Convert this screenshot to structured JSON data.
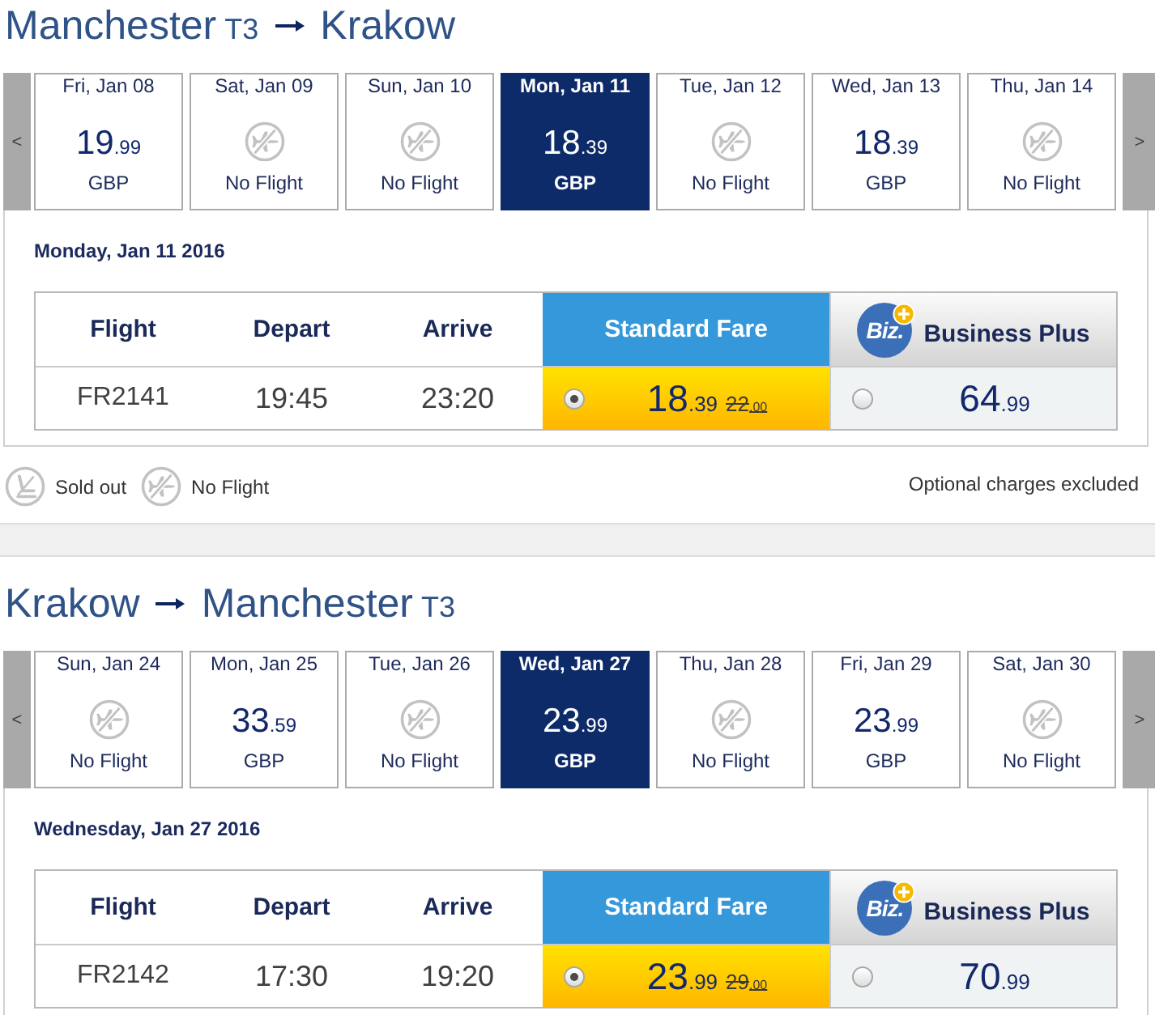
{
  "outbound": {
    "from": {
      "city": "Manchester",
      "terminal": "T3"
    },
    "to": {
      "city": "Krakow"
    },
    "nav": {
      "prev": "<",
      "next": ">"
    },
    "dates": [
      {
        "kind": "fare",
        "label": "Fri, Jan 08",
        "price": {
          "whole": "19",
          "decimals": ".99"
        },
        "currency": "GBP",
        "selected": false
      },
      {
        "kind": "no_flight",
        "label": "Sat, Jan 09",
        "status": "No Flight",
        "selected": false
      },
      {
        "kind": "no_flight",
        "label": "Sun, Jan 10",
        "status": "No Flight",
        "selected": false
      },
      {
        "kind": "fare",
        "label": "Mon, Jan 11",
        "price": {
          "whole": "18",
          "decimals": ".39"
        },
        "currency": "GBP",
        "selected": true
      },
      {
        "kind": "no_flight",
        "label": "Tue, Jan 12",
        "status": "No Flight",
        "selected": false
      },
      {
        "kind": "fare",
        "label": "Wed, Jan 13",
        "price": {
          "whole": "18",
          "decimals": ".39"
        },
        "currency": "GBP",
        "selected": false
      },
      {
        "kind": "no_flight",
        "label": "Thu, Jan 14",
        "status": "No Flight",
        "selected": false
      }
    ],
    "day_heading": "Monday, Jan 11 2016",
    "table": {
      "columns": [
        "Flight",
        "Depart",
        "Arrive"
      ],
      "fare_columns": [
        {
          "kind": "standard",
          "name": "Standard Fare"
        },
        {
          "kind": "business",
          "name": "Business Plus",
          "logo": "Biz."
        }
      ],
      "rows": [
        {
          "flight": "FR2141",
          "depart": "19:45",
          "arrive": "23:20",
          "fares": [
            {
              "price": {
                "whole": "18",
                "decimals": ".39"
              },
              "old_price": {
                "whole": "22",
                "decimals": ".00"
              },
              "selected": true
            },
            {
              "price": {
                "whole": "64",
                "decimals": ".99"
              },
              "selected": false
            }
          ]
        }
      ]
    }
  },
  "legend": {
    "items": [
      {
        "kind": "sold_out",
        "label": "Sold out"
      },
      {
        "kind": "no_flight",
        "label": "No Flight"
      }
    ],
    "note": "Optional charges excluded"
  },
  "inbound": {
    "from": {
      "city": "Krakow"
    },
    "to": {
      "city": "Manchester",
      "terminal": "T3"
    },
    "nav": {
      "prev": "<",
      "next": ">"
    },
    "dates": [
      {
        "kind": "no_flight",
        "label": "Sun, Jan 24",
        "status": "No Flight",
        "selected": false
      },
      {
        "kind": "fare",
        "label": "Mon, Jan 25",
        "price": {
          "whole": "33",
          "decimals": ".59"
        },
        "currency": "GBP",
        "selected": false
      },
      {
        "kind": "no_flight",
        "label": "Tue, Jan 26",
        "status": "No Flight",
        "selected": false
      },
      {
        "kind": "fare",
        "label": "Wed, Jan 27",
        "price": {
          "whole": "23",
          "decimals": ".99"
        },
        "currency": "GBP",
        "selected": true
      },
      {
        "kind": "no_flight",
        "label": "Thu, Jan 28",
        "status": "No Flight",
        "selected": false
      },
      {
        "kind": "fare",
        "label": "Fri, Jan 29",
        "price": {
          "whole": "23",
          "decimals": ".99"
        },
        "currency": "GBP",
        "selected": false
      },
      {
        "kind": "no_flight",
        "label": "Sat, Jan 30",
        "status": "No Flight",
        "selected": false
      }
    ],
    "day_heading": "Wednesday, Jan 27 2016",
    "table": {
      "columns": [
        "Flight",
        "Depart",
        "Arrive"
      ],
      "fare_columns": [
        {
          "kind": "standard",
          "name": "Standard Fare"
        },
        {
          "kind": "business",
          "name": "Business Plus",
          "logo": "Biz."
        }
      ],
      "rows": [
        {
          "flight": "FR2142",
          "depart": "17:30",
          "arrive": "19:20",
          "fares": [
            {
              "price": {
                "whole": "23",
                "decimals": ".99"
              },
              "old_price": {
                "whole": "29",
                "decimals": ".00"
              },
              "selected": true
            },
            {
              "price": {
                "whole": "70",
                "decimals": ".99"
              },
              "selected": false
            }
          ]
        }
      ]
    }
  }
}
